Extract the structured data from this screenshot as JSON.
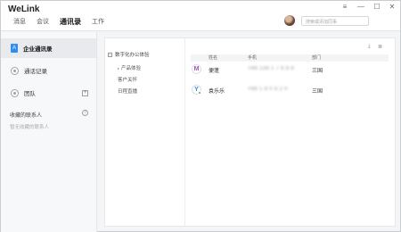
{
  "app": {
    "title": "WeLink"
  },
  "nav": [
    "消息",
    "会议",
    "通讯录",
    "工作"
  ],
  "search": {
    "placeholder": "搜索或添加同事"
  },
  "window_controls": {
    "settings": "≡",
    "minimize": "—",
    "maximize": "☐",
    "close": "✕"
  },
  "sidebar": {
    "items": [
      {
        "label": "企业通讯录",
        "icon": "A"
      },
      {
        "label": "通话记录"
      },
      {
        "label": "团队",
        "action": "+"
      }
    ],
    "favorites": {
      "title": "收藏的联系人",
      "help": "?",
      "empty": "暂无收藏的联系人"
    }
  },
  "tree": {
    "root": {
      "label": "数字化办公体验",
      "toggle": "−"
    },
    "children": [
      {
        "label": "产品体验",
        "caret": "▸"
      },
      {
        "label": "客户关怀"
      },
      {
        "label": "日程直播"
      }
    ]
  },
  "toolbar": {
    "download": "⤓",
    "list": "≣"
  },
  "table": {
    "columns": [
      "姓名",
      "手机",
      "部门"
    ],
    "rows": [
      {
        "avatar": "M",
        "avatar_color": "#9b59b6",
        "name": "便蓬",
        "phone": "+86 138 1 7 6 8 8",
        "dept": "三国"
      },
      {
        "avatar": "Y",
        "avatar_color": "#2f8cf0",
        "name": "袁乐乐",
        "phone": "+86 1 8 0 8 2 0",
        "dept": "三国"
      }
    ]
  }
}
